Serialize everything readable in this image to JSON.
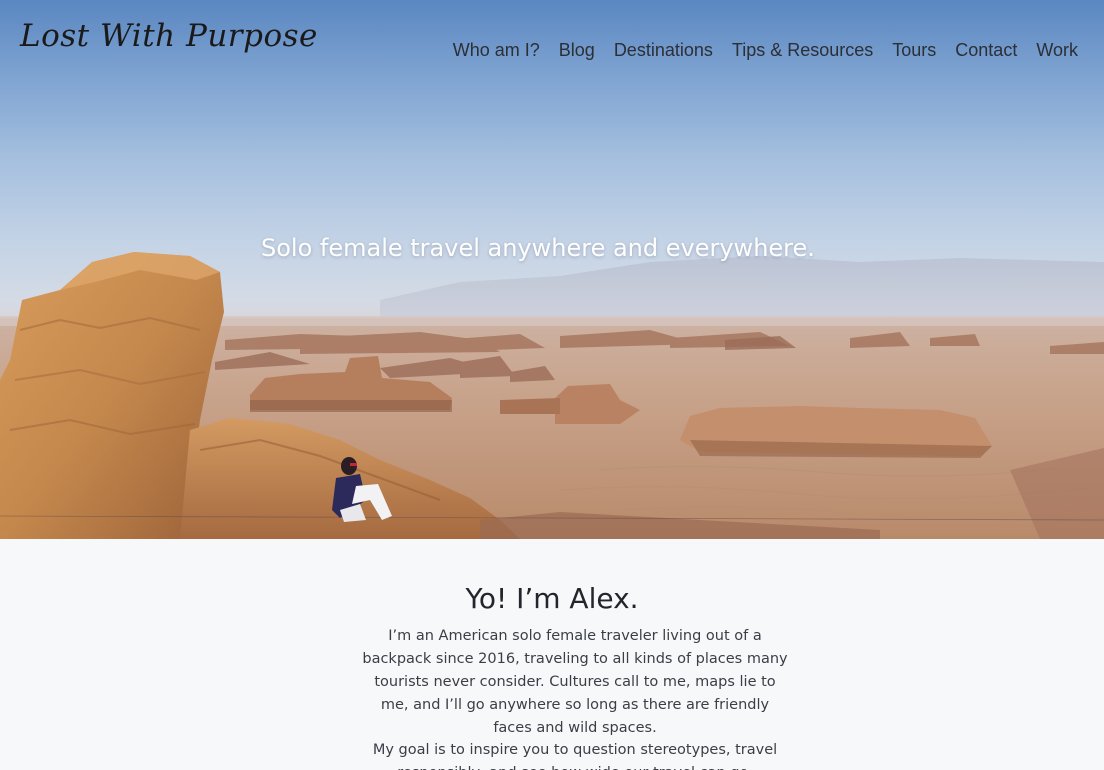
{
  "site": {
    "logo_text": "Lost With Purpose"
  },
  "nav": {
    "items": [
      {
        "label": "Who am I?"
      },
      {
        "label": "Blog"
      },
      {
        "label": "Destinations"
      },
      {
        "label": "Tips & Resources"
      },
      {
        "label": "Tours"
      },
      {
        "label": "Contact"
      },
      {
        "label": "Work"
      }
    ]
  },
  "hero": {
    "tagline": "Solo female travel anywhere and everywhere.",
    "image_subject": "desert-landscape-with-seated-traveler"
  },
  "intro": {
    "title": "Yo! I’m Alex.",
    "paragraph_1": "I’m an American solo female traveler living out of a backpack since 2016, traveling to all kinds of places many tourists never consider. Cultures call to me, maps lie to me, and I’ll go anywhere so long as there are friendly faces and wild spaces.",
    "paragraph_2": "My goal is to inspire you to question stereotypes, travel responsibly, and see how wide our travel can go."
  },
  "colors": {
    "sky_top": "#5a87c1",
    "sand": "#c9a58a",
    "rock": "#c98a4e",
    "intro_bg": "#f7f8fa",
    "nav_text": "#2b2f36"
  }
}
